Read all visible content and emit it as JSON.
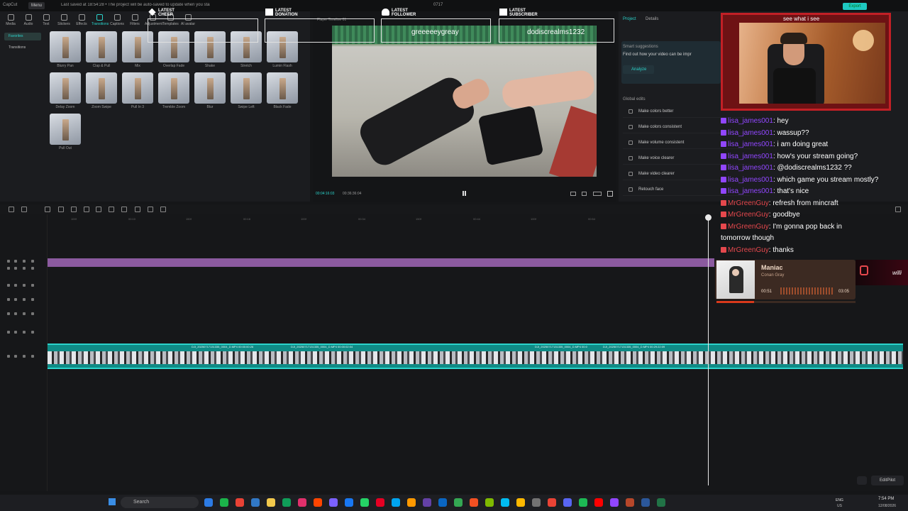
{
  "app": {
    "title": "CapCut",
    "menu_label": "Menu",
    "save_status": "Last saved at 18:54:28 • The project will be auto-saved to update when you start",
    "project_name": "0717",
    "export_label": "Export"
  },
  "toolbar": {
    "tools": [
      "Media",
      "Audio",
      "Text",
      "Stickers",
      "Effects",
      "Transitions",
      "Captions",
      "Filters",
      "Adjustment",
      "Templates",
      "AI avatar"
    ],
    "active_tool": "Transitions"
  },
  "sidebar": {
    "items": [
      "Favorites",
      "Transitions"
    ]
  },
  "transitions": [
    {
      "label": "Blurry Pan"
    },
    {
      "label": "Clap & Pull"
    },
    {
      "label": "Mix"
    },
    {
      "label": "Overlap Fade"
    },
    {
      "label": "Shake"
    },
    {
      "label": "Stretch"
    },
    {
      "label": "Lumin Flash"
    },
    {
      "label": "Delay Zoom"
    },
    {
      "label": "Zoom Swipe"
    },
    {
      "label": "Pull In 3"
    },
    {
      "label": "Tremble Zoom"
    },
    {
      "label": "Blur"
    },
    {
      "label": "Swipe Left"
    },
    {
      "label": "Black Fade"
    },
    {
      "label": "Pull Out"
    }
  ],
  "player": {
    "title": "Player Timeline 01",
    "current_time": "00:04:16:03",
    "total_time": "00:36:36:04"
  },
  "right_panel": {
    "tabs": [
      "Project",
      "Details"
    ],
    "smart_suggestions_title": "Smart suggestions",
    "smart_suggestions_text": "Find out how your video can be impr",
    "analyze_label": "Analyze",
    "global_edits_title": "Global edits",
    "global_edits": [
      "Make colors better",
      "Make colors consistent",
      "Make volume consistent",
      "Make voice clearer",
      "Make video clearer",
      "Retouch face"
    ]
  },
  "timeline": {
    "ruler": [
      "100f",
      "00:10",
      "150f",
      "00:18",
      "100f",
      "00:34",
      "150f",
      "00:44",
      "100f",
      "00:54"
    ],
    "clip_labels": [
      "DJI_20250717131335_0004_D.MP4   00:00:00:26",
      "DJI_20250717131335_0004_D.MP4   00:00:02:04",
      "DJI_20250717131335_0004_D.MP4   00:0",
      "DJI_20250717131335_0004_D.MP4   00:29:22:09"
    ]
  },
  "stream_overlay": {
    "alerts": [
      {
        "title_top": "LATEST",
        "title_bottom": "CHEER",
        "name": ""
      },
      {
        "title_top": "LATEST",
        "title_bottom": "DONATION",
        "name": ""
      },
      {
        "title_top": "LATEST",
        "title_bottom": "FOLLOWER",
        "name": "greeeeeygreay"
      },
      {
        "title_top": "LATEST",
        "title_bottom": "SUBSCRIBER",
        "name": "dodiscrealms1232"
      }
    ],
    "webcam_caption": "see what i see",
    "chat": [
      {
        "user": "lisa_james001",
        "pronoun": "",
        "message": ": hey",
        "platform": "twitch"
      },
      {
        "user": "lisa_james001",
        "pronoun": "",
        "message": ": wassup??",
        "platform": "twitch"
      },
      {
        "user": "lisa_james001",
        "pronoun": "",
        "message": ": i am doing great",
        "platform": "twitch"
      },
      {
        "user": "lisa_james001",
        "pronoun": "",
        "message": ": how's your stream going?",
        "platform": "twitch"
      },
      {
        "user": "lisa_james001",
        "pronoun": "",
        "message": ": @dodiscrealms1232 ??",
        "platform": "twitch"
      },
      {
        "user": "lisa_james001",
        "pronoun": "",
        "message": ": which game you stream mostly?",
        "platform": "twitch"
      },
      {
        "user": "lisa_james001",
        "pronoun": "",
        "message": ": that's nice",
        "platform": "twitch"
      },
      {
        "user": "MrGreenGuy",
        "pronoun": "",
        "message": ": refresh from mincraft",
        "platform": "tiktok"
      },
      {
        "user": "MrGreenGuy",
        "pronoun": "",
        "message": ": goodbye",
        "platform": "tiktok"
      },
      {
        "user": "MrGreenGuy",
        "pronoun": "",
        "message": ": I'm gonna pop back in",
        "platform": "tiktok"
      },
      {
        "user": "",
        "pronoun": "",
        "message": "tomorrow though",
        "platform": "none"
      },
      {
        "user": "MrGreenGuy",
        "pronoun": "",
        "message": ": thanks",
        "platform": "tiktok"
      }
    ],
    "now_playing": {
      "title": "Maniac",
      "artist": "Conan Gray",
      "elapsed": "00:51",
      "total": "03:05",
      "progress": 0.27
    },
    "tiktok_handle": "willi"
  },
  "editpilot_label": "EditPilot",
  "taskbar": {
    "search_placeholder": "Search",
    "lang": "ENG",
    "lang_sub": "US",
    "time": "7:54 PM",
    "date": "12/08/2026"
  },
  "colors": {
    "accent": "#2bd3cb",
    "twitch": "#9146ff",
    "tiktok": "#e5484d",
    "webcam_border": "#c22026"
  }
}
